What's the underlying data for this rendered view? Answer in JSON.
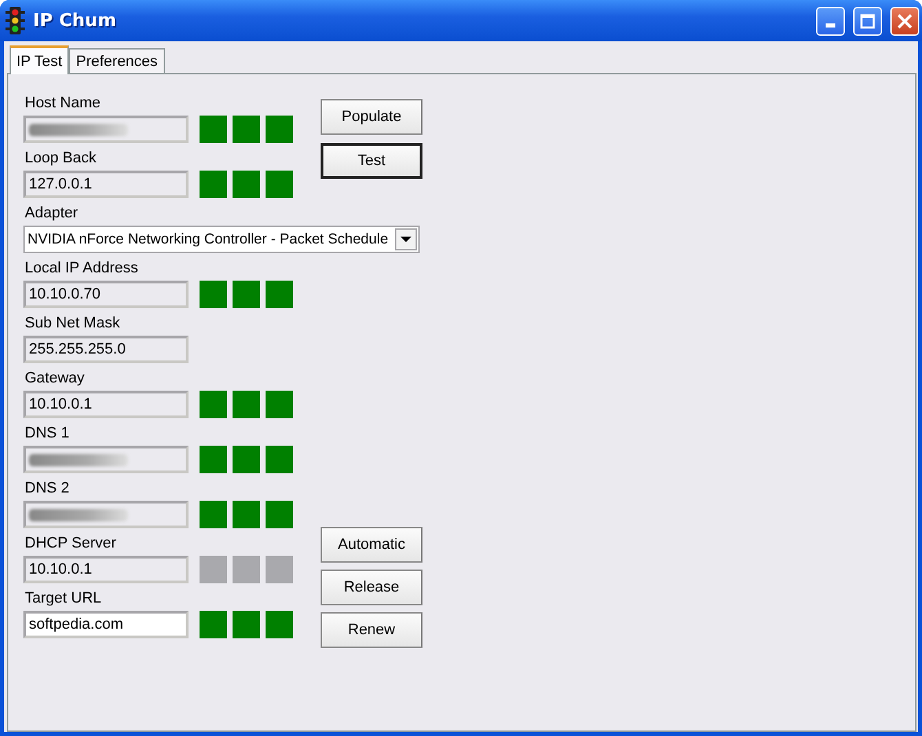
{
  "window": {
    "title": "IP Chum"
  },
  "tabs": [
    {
      "label": "IP Test",
      "selected": true
    },
    {
      "label": "Preferences",
      "selected": false
    }
  ],
  "fields": [
    {
      "label": "Host Name",
      "redacted": true,
      "editable": false,
      "lights": [
        {
          "color": "#008000"
        },
        {
          "color": "#008000"
        },
        {
          "color": "#008000"
        }
      ]
    },
    {
      "label": "Loop Back",
      "value": "127.0.0.1",
      "editable": false,
      "lights": [
        {
          "color": "#008000"
        },
        {
          "color": "#008000"
        },
        {
          "color": "#008000"
        }
      ]
    },
    {
      "label": "Adapter",
      "kind": "dropdown",
      "value": "NVIDIA nForce Networking Controller - Packet Schedule"
    },
    {
      "label": "Local IP Address",
      "value": "10.10.0.70",
      "editable": false,
      "lights": [
        {
          "color": "#008000"
        },
        {
          "color": "#008000"
        },
        {
          "color": "#008000"
        }
      ]
    },
    {
      "label": "Sub Net Mask",
      "value": "255.255.255.0",
      "editable": false
    },
    {
      "label": "Gateway",
      "value": "10.10.0.1",
      "editable": false,
      "lights": [
        {
          "color": "#008000"
        },
        {
          "color": "#008000"
        },
        {
          "color": "#008000"
        }
      ]
    },
    {
      "label": "DNS 1",
      "redacted": true,
      "editable": false,
      "lights": [
        {
          "color": "#008000"
        },
        {
          "color": "#008000"
        },
        {
          "color": "#008000"
        }
      ]
    },
    {
      "label": "DNS 2",
      "redacted": true,
      "editable": false,
      "lights": [
        {
          "color": "#008000"
        },
        {
          "color": "#008000"
        },
        {
          "color": "#008000"
        }
      ]
    },
    {
      "label": "DHCP Server",
      "value": "10.10.0.1",
      "editable": false,
      "lights": [
        {
          "color": "#a9a9ad"
        },
        {
          "color": "#a9a9ad"
        },
        {
          "color": "#a9a9ad"
        }
      ]
    },
    {
      "label": "Target URL",
      "value": "softpedia.com",
      "editable": true,
      "lights": [
        {
          "color": "#008000"
        },
        {
          "color": "#008000"
        },
        {
          "color": "#008000"
        }
      ]
    }
  ],
  "top_buttons": [
    {
      "label": "Populate",
      "default": false
    },
    {
      "label": "Test",
      "default": true
    }
  ],
  "bottom_buttons": [
    {
      "label": "Automatic",
      "default": false
    },
    {
      "label": "Release",
      "default": false
    },
    {
      "label": "Renew",
      "default": false
    }
  ]
}
